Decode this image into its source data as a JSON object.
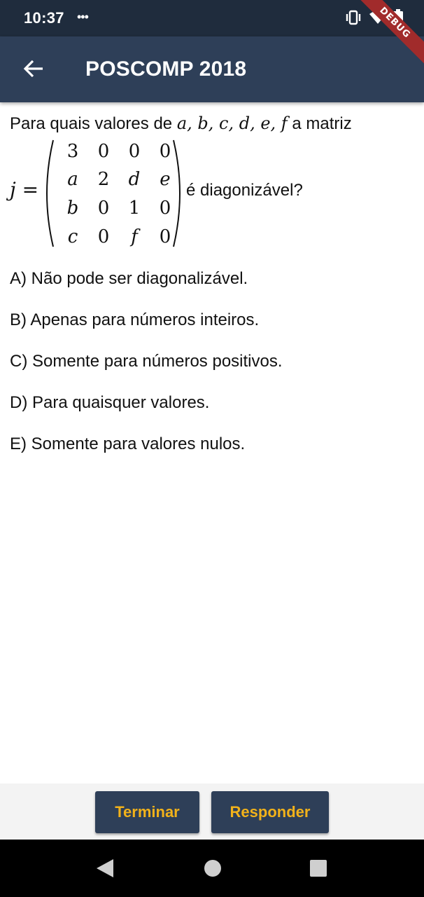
{
  "status_bar": {
    "time": "10:37",
    "notif_dots": "•••",
    "icons": [
      "vibrate-icon",
      "wifi-icon",
      "battery-icon"
    ]
  },
  "debug_banner": "DEBUG",
  "app_bar": {
    "title": "POSCOMP 2018",
    "back_icon": "arrow-left-icon"
  },
  "question": {
    "line1_prefix": "Para quais valores de ",
    "variables": "a, b, c, d, e, f",
    "line1_suffix": " a matriz",
    "matrix_lhs": "j =",
    "matrix": [
      [
        "3",
        "0",
        "0",
        "0"
      ],
      [
        "a",
        "2",
        "d",
        "e"
      ],
      [
        "b",
        "0",
        "1",
        "0"
      ],
      [
        "c",
        "0",
        "f",
        "0"
      ]
    ],
    "matrix_rhs": "é diagonizável?"
  },
  "options": [
    "A) Não pode ser diagonalizável.",
    "B) Apenas para números inteiros.",
    "C) Somente para números positivos.",
    "D) Para quaisquer valores.",
    "E) Somente para valores nulos."
  ],
  "actions": {
    "terminar": "Terminar",
    "responder": "Responder"
  },
  "colors": {
    "status_bar": "#1f2c3d",
    "app_bar": "#2e3f58",
    "button_text": "#f2b21a",
    "debug_ribbon": "#a12b2b"
  },
  "nav_bar": {
    "icons": [
      "back-triangle-icon",
      "home-circle-icon",
      "recents-square-icon"
    ]
  }
}
